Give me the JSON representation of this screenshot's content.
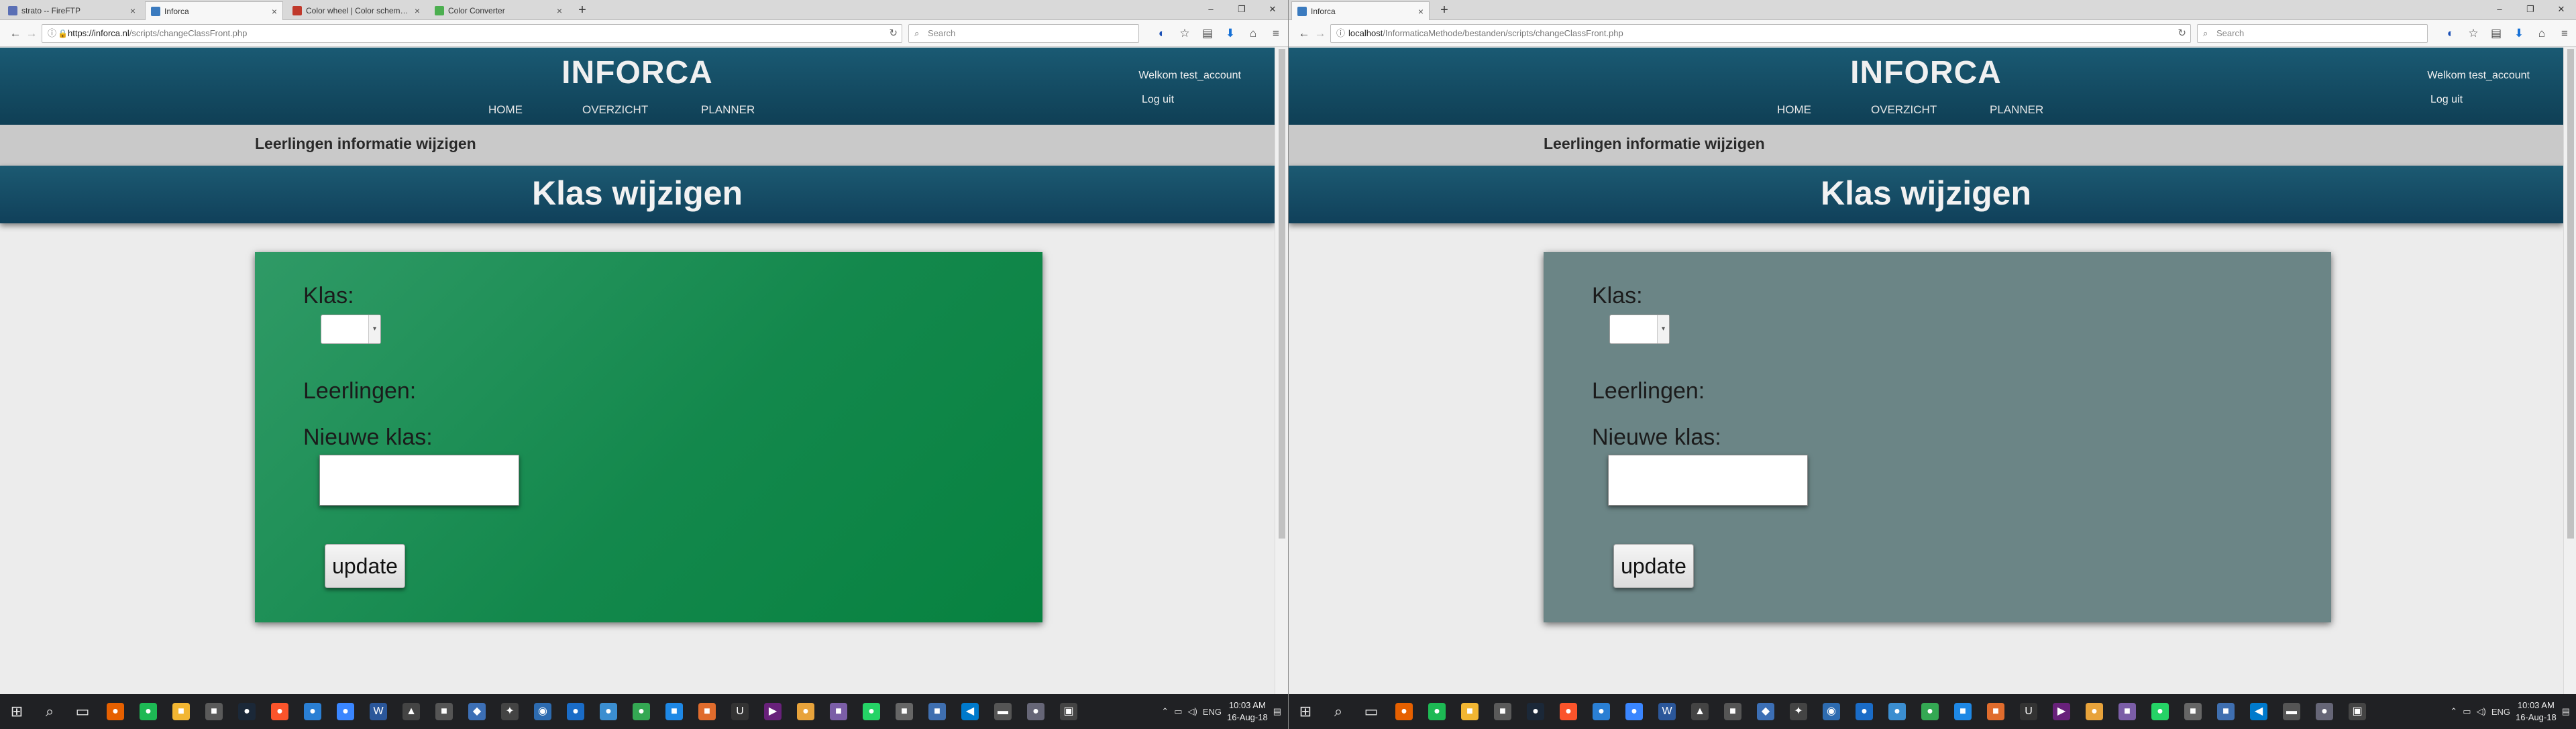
{
  "screens": [
    {
      "id": "left",
      "tabs": [
        {
          "label": "strato -- FireFTP",
          "color": "#5a6fb5"
        },
        {
          "label": "Inforca",
          "color": "#3b7bbf",
          "active": true
        },
        {
          "label": "Color wheel | Color schem…",
          "color": "#c0392b"
        },
        {
          "label": "Color Converter",
          "color": "#4caf50"
        }
      ],
      "url_host": "https://inforca.nl",
      "url_path": "/scripts/changeClassFront.php",
      "has_lock": true,
      "search_placeholder": "Search",
      "form_color": "#13884c"
    },
    {
      "id": "right",
      "tabs": [
        {
          "label": "Inforca",
          "color": "#3b7bbf",
          "active": true
        }
      ],
      "url_host": "localhost",
      "url_path": "/InformaticaMethode/bestanden/scripts/changeClassFront.php",
      "has_lock": false,
      "search_placeholder": "Search",
      "form_color": "#6b8586"
    }
  ],
  "site": {
    "title": "INFORCA",
    "nav": [
      "HOME",
      "OVERZICHT",
      "PLANNER"
    ],
    "welcome": "Welkom test_account",
    "logout": "Log uit",
    "subheader": "Leerlingen informatie wijzigen",
    "band_title": "Klas wijzigen",
    "form": {
      "klas_label": "Klas:",
      "leerlingen_label": "Leerlingen:",
      "nieuwe_klas_label": "Nieuwe klas:",
      "nieuwe_klas_value": "",
      "update_button": "update"
    }
  },
  "taskbar": {
    "time": "10:03 AM",
    "date": "16-Aug-18",
    "lang": "ENG",
    "icons": [
      {
        "name": "start-icon",
        "glyph": "⊞",
        "color": "transparent"
      },
      {
        "name": "search-icon",
        "glyph": "⌕",
        "color": "transparent"
      },
      {
        "name": "task-view-icon",
        "glyph": "▭",
        "color": "transparent"
      },
      {
        "name": "firefox-icon",
        "glyph": "●",
        "color": "#e66000"
      },
      {
        "name": "spotify-icon",
        "glyph": "●",
        "color": "#1db954"
      },
      {
        "name": "explorer-icon",
        "glyph": "■",
        "color": "#f2b632"
      },
      {
        "name": "app-icon",
        "glyph": "■",
        "color": "#5a5a5a"
      },
      {
        "name": "steam-icon",
        "glyph": "●",
        "color": "#1b2838"
      },
      {
        "name": "brave-icon",
        "glyph": "●",
        "color": "#fb542b"
      },
      {
        "name": "app-icon",
        "glyph": "●",
        "color": "#2a7fd4"
      },
      {
        "name": "app-icon",
        "glyph": "●",
        "color": "#3a86ff"
      },
      {
        "name": "word-icon",
        "glyph": "W",
        "color": "#2b579a"
      },
      {
        "name": "app-icon",
        "glyph": "▲",
        "color": "#444"
      },
      {
        "name": "app-icon",
        "glyph": "■",
        "color": "#555"
      },
      {
        "name": "app-icon",
        "glyph": "◆",
        "color": "#3c6fb5"
      },
      {
        "name": "app-icon",
        "glyph": "✦",
        "color": "#444"
      },
      {
        "name": "app-icon",
        "glyph": "◉",
        "color": "#2d6bb0"
      },
      {
        "name": "app-icon",
        "glyph": "●",
        "color": "#1a6cc7"
      },
      {
        "name": "app-icon",
        "glyph": "●",
        "color": "#3b8ed0"
      },
      {
        "name": "app-icon",
        "glyph": "●",
        "color": "#34a853"
      },
      {
        "name": "app-icon",
        "glyph": "■",
        "color": "#1e88e5"
      },
      {
        "name": "app-icon",
        "glyph": "■",
        "color": "#e06c2d"
      },
      {
        "name": "unreal-icon",
        "glyph": "U",
        "color": "#333"
      },
      {
        "name": "visual-studio-icon",
        "glyph": "▶",
        "color": "#68217a"
      },
      {
        "name": "app-icon",
        "glyph": "●",
        "color": "#e8a33b"
      },
      {
        "name": "app-icon",
        "glyph": "■",
        "color": "#7b5ea7"
      },
      {
        "name": "whatsapp-icon",
        "glyph": "●",
        "color": "#25d366"
      },
      {
        "name": "app-icon",
        "glyph": "■",
        "color": "#666"
      },
      {
        "name": "app-icon",
        "glyph": "■",
        "color": "#3f6fb0"
      },
      {
        "name": "vscode-icon",
        "glyph": "◀",
        "color": "#007acc"
      },
      {
        "name": "app-icon",
        "glyph": "▬",
        "color": "#555"
      },
      {
        "name": "app-icon",
        "glyph": "●",
        "color": "#667"
      },
      {
        "name": "app-icon",
        "glyph": "▣",
        "color": "#444"
      }
    ]
  }
}
